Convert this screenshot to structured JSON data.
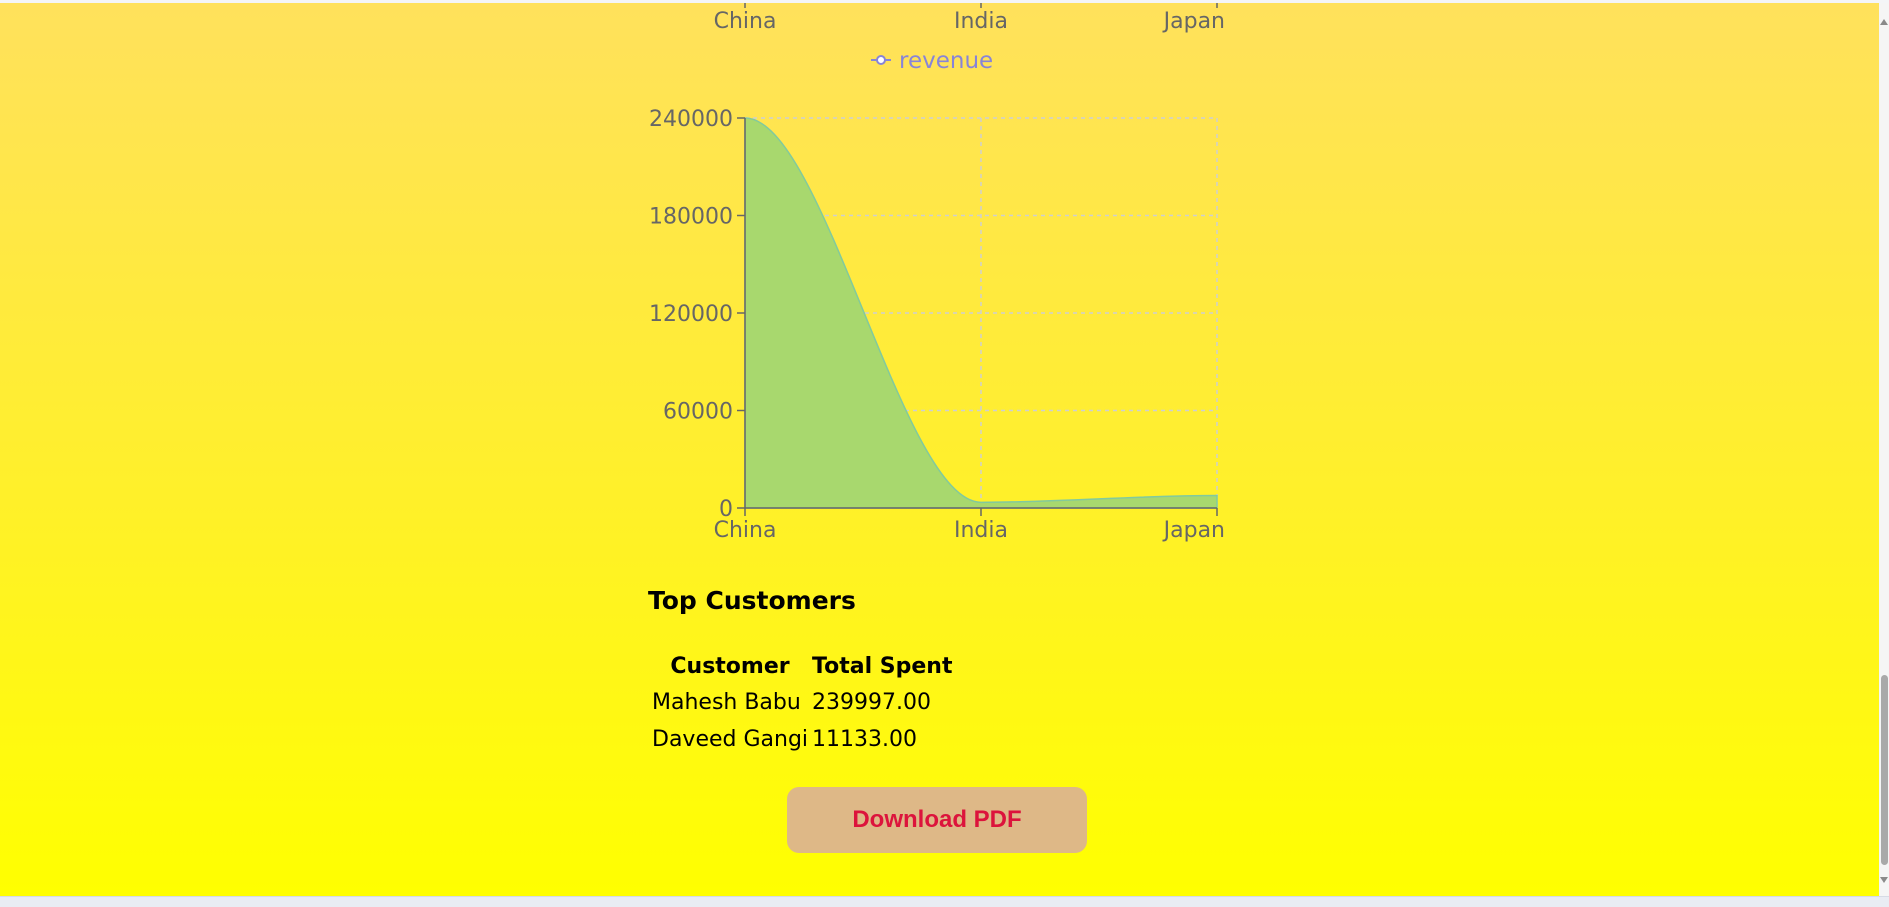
{
  "colors": {
    "axis": "#666666",
    "grid": "#cfcfcf",
    "legend_text": "#8884d8",
    "area_fill": "#a8d86e",
    "area_stroke": "#82ca9d",
    "button_bg": "#deb887",
    "button_text": "#dc143c"
  },
  "chart_data": [
    {
      "type": "line",
      "partially_visible": true,
      "categories": [
        "China",
        "India",
        "Japan"
      ],
      "legend": "revenue",
      "legend_position": "bottom"
    },
    {
      "type": "area",
      "categories": [
        "China",
        "India",
        "Japan"
      ],
      "values": [
        239997,
        3500,
        7700
      ],
      "ylim": [
        0,
        240000
      ],
      "yticks": [
        0,
        60000,
        120000,
        180000,
        240000
      ],
      "grid": true
    }
  ],
  "top_customers": {
    "title": "Top Customers",
    "headers": [
      "Customer",
      "Total Spent"
    ],
    "rows": [
      [
        "Mahesh Babu",
        "239997.00"
      ],
      [
        "Daveed Gangi",
        "11133.00"
      ]
    ]
  },
  "download_button": {
    "label": "Download PDF"
  }
}
